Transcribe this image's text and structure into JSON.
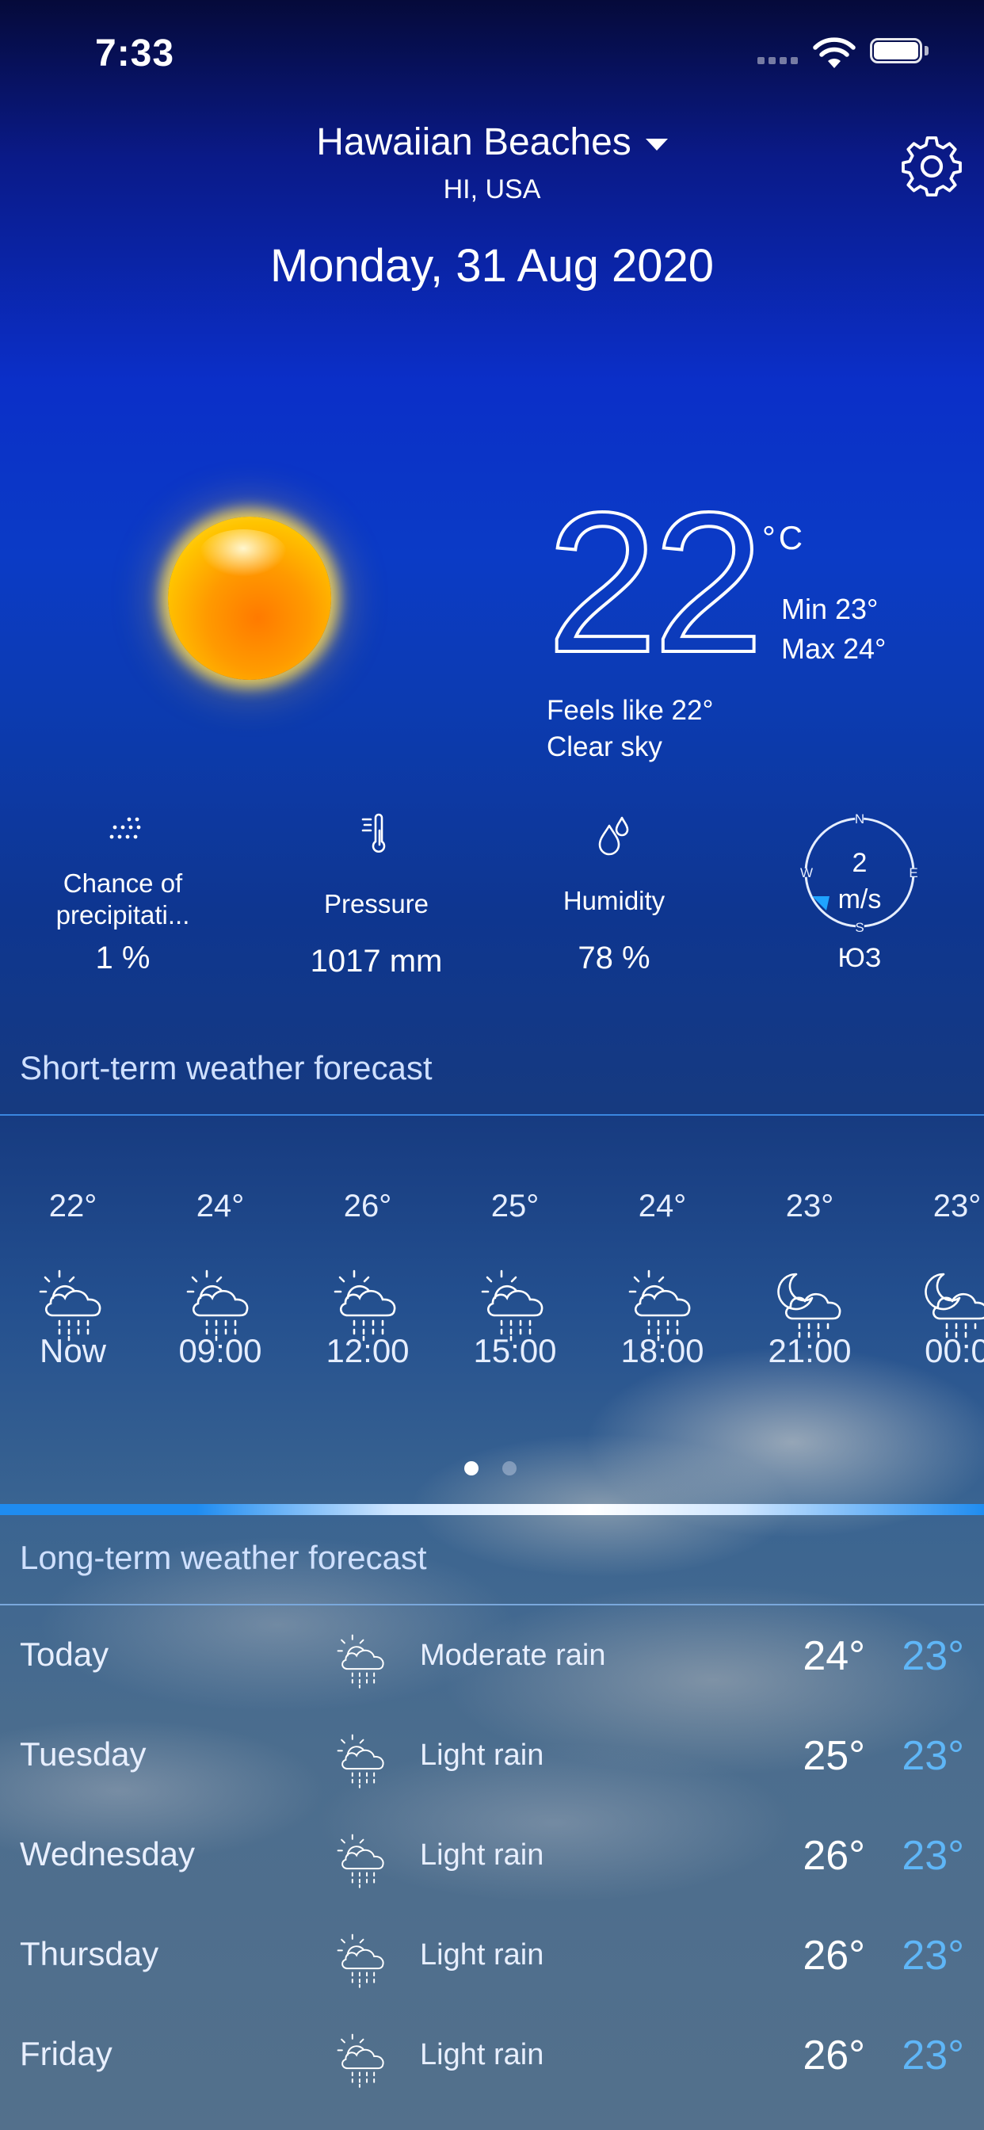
{
  "status_bar": {
    "time": "7:33",
    "icons": [
      "signal-icon",
      "wifi-icon",
      "battery-icon"
    ]
  },
  "header": {
    "city": "Hawaiian Beaches",
    "region": "HI, USA",
    "date": "Monday, 31 Aug 2020",
    "settings_icon": "gear-icon"
  },
  "current": {
    "icon": "sun-icon",
    "temperature": "22",
    "unit": "°C",
    "min": "Min 23°",
    "max": "Max 24°",
    "feels_like": "Feels like 22°",
    "condition": "Clear sky"
  },
  "stats": [
    {
      "icon": "precipitation-icon",
      "label": "Chance of precipitati...",
      "value": "1 %"
    },
    {
      "icon": "thermometer-icon",
      "label": "Pressure",
      "value": "1017 mm"
    },
    {
      "icon": "humidity-icon",
      "label": "Humidity",
      "value": "78 %"
    }
  ],
  "wind": {
    "speed": "2",
    "unit": "m/s",
    "direction": "ЮЗ",
    "compass": [
      "N",
      "E",
      "S",
      "W"
    ]
  },
  "short_term": {
    "title": "Short-term weather forecast",
    "hours": [
      {
        "temp": "22°",
        "label": "Now",
        "icon": "sun-cloud-rain-icon"
      },
      {
        "temp": "24°",
        "label": "09:00",
        "icon": "sun-cloud-rain-icon"
      },
      {
        "temp": "26°",
        "label": "12:00",
        "icon": "sun-cloud-rain-icon"
      },
      {
        "temp": "25°",
        "label": "15:00",
        "icon": "sun-cloud-rain-icon"
      },
      {
        "temp": "24°",
        "label": "18:00",
        "icon": "sun-cloud-rain-icon"
      },
      {
        "temp": "23°",
        "label": "21:00",
        "icon": "moon-cloud-rain-icon"
      },
      {
        "temp": "23°",
        "label": "00:0",
        "icon": "moon-cloud-rain-icon"
      }
    ],
    "pages": 2,
    "active_page": 1
  },
  "long_term": {
    "title": "Long-term weather forecast",
    "days": [
      {
        "day": "Today",
        "condition": "Moderate rain",
        "max": "24°",
        "min": "23°",
        "icon": "sun-cloud-rain-icon"
      },
      {
        "day": "Tuesday",
        "condition": "Light rain",
        "max": "25°",
        "min": "23°",
        "icon": "sun-cloud-rain-icon"
      },
      {
        "day": "Wednesday",
        "condition": "Light rain",
        "max": "26°",
        "min": "23°",
        "icon": "sun-cloud-rain-icon"
      },
      {
        "day": "Thursday",
        "condition": "Light rain",
        "max": "26°",
        "min": "23°",
        "icon": "sun-cloud-rain-icon"
      },
      {
        "day": "Friday",
        "condition": "Light rain",
        "max": "26°",
        "min": "23°",
        "icon": "sun-cloud-rain-icon"
      }
    ]
  }
}
